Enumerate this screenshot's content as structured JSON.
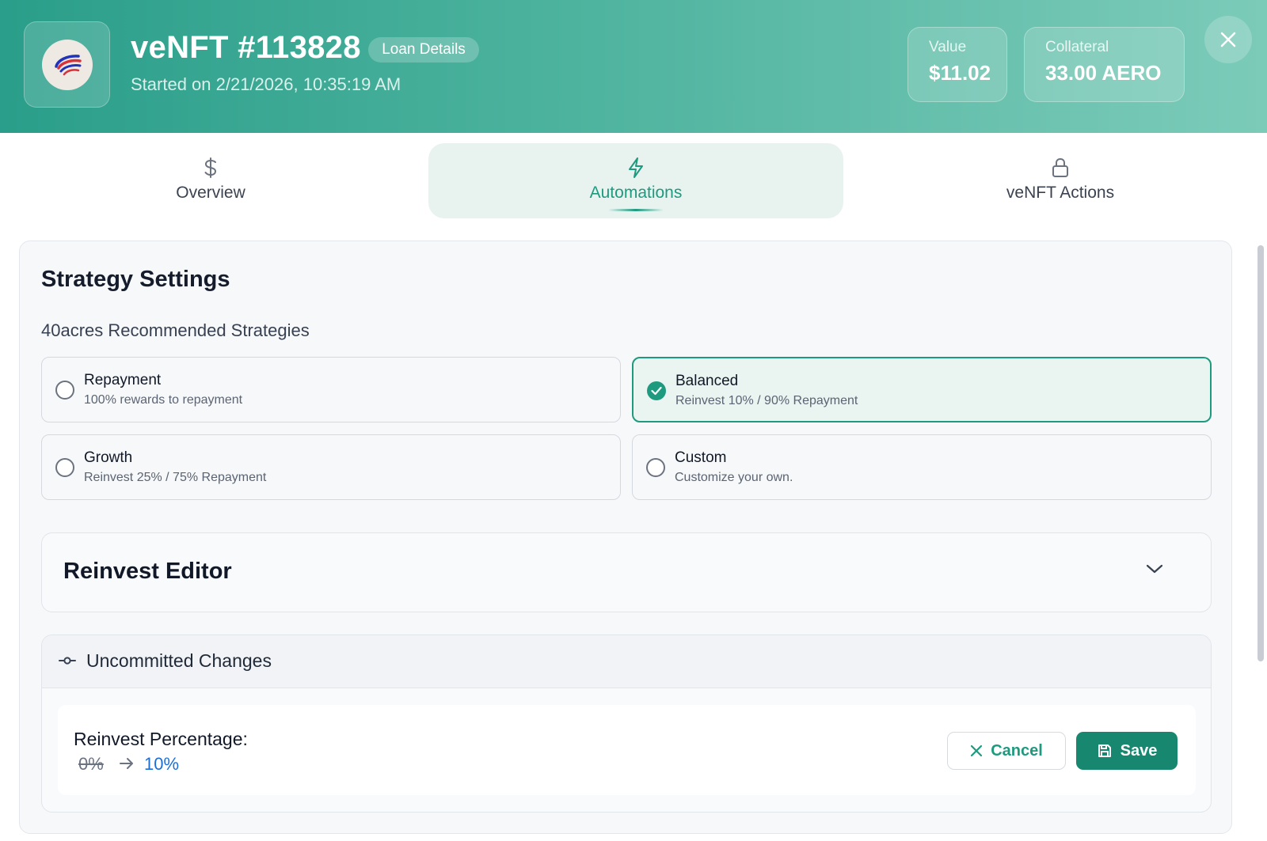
{
  "header": {
    "title": "veNFT #113828",
    "badge": "Loan Details",
    "started": "Started on 2/21/2026, 10:35:19 AM",
    "value_label": "Value",
    "value": "$11.02",
    "collateral_label": "Collateral",
    "collateral": "33.00 AERO"
  },
  "tabs": [
    {
      "label": "Overview",
      "icon": "dollar-icon",
      "active": false
    },
    {
      "label": "Automations",
      "icon": "lightning-icon",
      "active": true
    },
    {
      "label": "veNFT Actions",
      "icon": "lock-icon",
      "active": false
    }
  ],
  "strategy": {
    "title": "Strategy Settings",
    "subtitle": "40acres Recommended Strategies",
    "options": [
      {
        "title": "Repayment",
        "desc": "100% rewards to repayment",
        "selected": false
      },
      {
        "title": "Balanced",
        "desc": "Reinvest 10% / 90% Repayment",
        "selected": true
      },
      {
        "title": "Growth",
        "desc": "Reinvest 25% / 75% Repayment",
        "selected": false
      },
      {
        "title": "Custom",
        "desc": "Customize your own.",
        "selected": false
      }
    ]
  },
  "editor": {
    "title": "Reinvest Editor"
  },
  "changes": {
    "title": "Uncommitted Changes",
    "label": "Reinvest Percentage:",
    "old_value": "0%",
    "new_value": "10%",
    "cancel_label": "Cancel",
    "save_label": "Save"
  },
  "colors": {
    "accent": "#1e9a7f",
    "header_start": "#2a9e8a",
    "header_end": "#7ccbb9",
    "new_value": "#1d6fd6"
  }
}
